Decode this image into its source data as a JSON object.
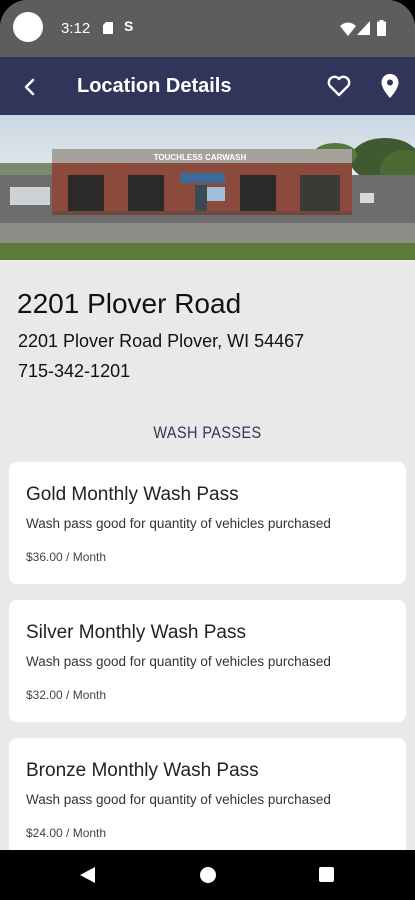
{
  "status_bar": {
    "time": "3:12",
    "icons": [
      "sd-card-icon",
      "s-notification-icon",
      "wifi-icon",
      "cell-signal-icon",
      "battery-icon"
    ]
  },
  "app_bar": {
    "title": "Location Details",
    "back_icon": "chevron-left-icon",
    "actions": [
      "heart-icon",
      "map-pin-icon"
    ],
    "color": "#303559"
  },
  "hero": {
    "sign_text": "TOUCHLESS CARWASH"
  },
  "location": {
    "title": "2201 Plover Road",
    "address": "2201 Plover Road Plover, WI 54467",
    "phone": "715-342-1201"
  },
  "section_label": "WASH PASSES",
  "passes": [
    {
      "name": "Gold Monthly Wash Pass",
      "description": "Wash pass good for quantity of vehicles purchased",
      "price": "$36.00 / Month"
    },
    {
      "name": "Silver Monthly Wash Pass",
      "description": "Wash pass good for quantity of vehicles purchased",
      "price": "$32.00 / Month"
    },
    {
      "name": "Bronze Monthly Wash Pass",
      "description": "Wash pass good for quantity of vehicles purchased",
      "price": "$24.00 / Month"
    }
  ],
  "nav_bar": {
    "buttons": [
      "back-triangle-icon",
      "home-circle-icon",
      "recents-square-icon"
    ]
  }
}
